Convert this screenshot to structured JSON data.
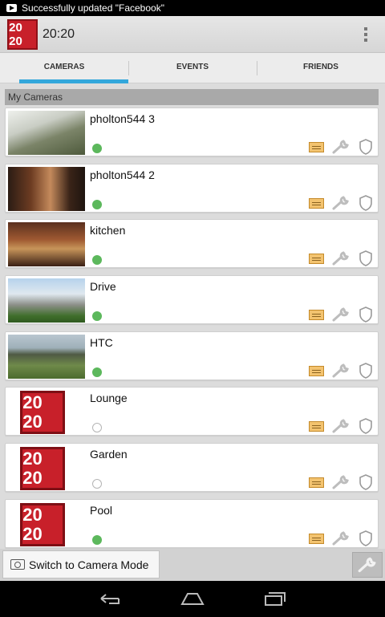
{
  "status_bar": {
    "notification": "Successfully updated \"Facebook\""
  },
  "action_bar": {
    "time": "20:20",
    "logo_digits": [
      "20",
      "20"
    ]
  },
  "tabs": [
    {
      "label": "CAMERAS",
      "active": true
    },
    {
      "label": "EVENTS",
      "active": false
    },
    {
      "label": "FRIENDS",
      "active": false
    }
  ],
  "section_header": "My Cameras",
  "cameras": [
    {
      "name": "pholton544 3",
      "online": true,
      "thumbnail": "photo"
    },
    {
      "name": "pholton544 2",
      "online": true,
      "thumbnail": "photo"
    },
    {
      "name": "kitchen",
      "online": true,
      "thumbnail": "photo"
    },
    {
      "name": "Drive",
      "online": true,
      "thumbnail": "photo"
    },
    {
      "name": "HTC",
      "online": true,
      "thumbnail": "photo"
    },
    {
      "name": "Lounge",
      "online": false,
      "thumbnail": "logo"
    },
    {
      "name": "Garden",
      "online": false,
      "thumbnail": "logo"
    },
    {
      "name": "Pool",
      "online": true,
      "thumbnail": "logo"
    }
  ],
  "bottom_bar": {
    "switch_label": "Switch to Camera Mode"
  },
  "colors": {
    "accent": "#33a7db",
    "online": "#5cb85c",
    "brand": "#c8202a"
  }
}
